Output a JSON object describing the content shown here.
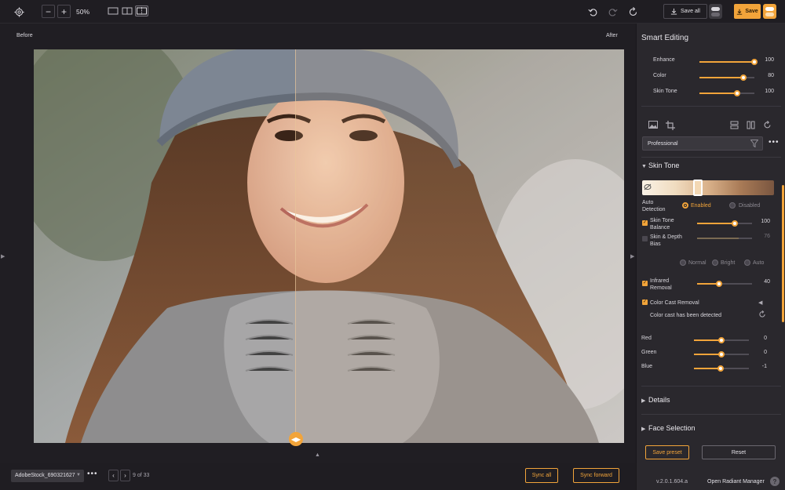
{
  "toolbar": {
    "zoom_label": "50%",
    "zoom_out_icon": "minus-icon",
    "zoom_in_icon": "plus-icon",
    "save_all_label": "Save all",
    "save_label": "Save",
    "accent": "#f2a43a"
  },
  "canvas": {
    "before_label": "Before",
    "after_label": "After"
  },
  "bottom": {
    "file_name": "AdobeStock_690321627",
    "page_info": "9 of 33",
    "sync_all_label": "Sync all",
    "sync_forward_label": "Sync forward"
  },
  "panel": {
    "title": "Smart Editing",
    "smart_sliders": [
      {
        "label": "Enhance",
        "value": "100",
        "level": 1.0
      },
      {
        "label": "Color",
        "value": "80",
        "level": 0.8
      },
      {
        "label": "Skin Tone",
        "value": "100",
        "level": 0.68
      }
    ],
    "preset": "Professional",
    "skin_tone": {
      "heading": "Skin Tone",
      "auto_detection_label": "Auto\nDetection",
      "enabled_label": "Enabled",
      "disabled_label": "Disabled",
      "balance_label": "Skin Tone\nBalance",
      "balance_value": "100",
      "depth_label": "Skin & Depth\nBias",
      "depth_value": "76",
      "normal_label": "Normal",
      "bright_label": "Bright",
      "auto_label": "Auto",
      "infrared_label": "Infrared\nRemoval",
      "infrared_value": "40",
      "color_cast_label": "Color Cast Removal",
      "cast_detected_text": "Color cast has been detected",
      "rgb": [
        {
          "label": "Red",
          "value": "0",
          "level": 0.5
        },
        {
          "label": "Green",
          "value": "0",
          "level": 0.5
        },
        {
          "label": "Blue",
          "value": "-1",
          "level": 0.48
        }
      ]
    },
    "details_heading": "Details",
    "face_selection_heading": "Face Selection",
    "save_preset_label": "Save preset",
    "reset_label": "Reset",
    "version": "v.2.0.1.604.a",
    "open_manager_label": "Open Radiant Manager"
  }
}
